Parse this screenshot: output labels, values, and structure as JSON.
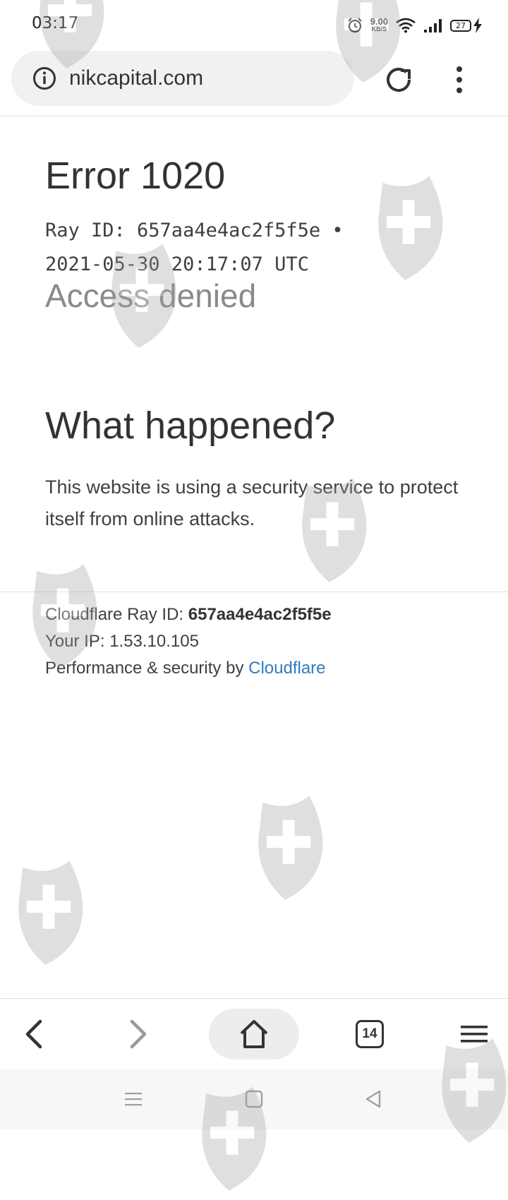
{
  "status_bar": {
    "time": "03:17",
    "net_speed_value": "9.00",
    "net_speed_unit": "KB/S",
    "battery": "27",
    "icons": [
      "alarm-icon",
      "wifi-icon",
      "signal-icon",
      "battery-icon",
      "charging-icon"
    ]
  },
  "browser": {
    "url": "nikcapital.com",
    "tab_count": "14",
    "icons": [
      "info-icon",
      "reload-icon",
      "more-vert-icon",
      "back-icon",
      "forward-icon",
      "home-icon",
      "tabs-icon",
      "menu-icon"
    ]
  },
  "page": {
    "error_title": "Error 1020",
    "ray_line1": "Ray ID: 657aa4e4ac2f5f5e •",
    "ray_line2": "2021-05-30 20:17:07 UTC",
    "access_denied": "Access denied",
    "what_happened": "What happened?",
    "explanation": "This website is using a security service to protect itself from online attacks.",
    "footer": {
      "ray_label": "Cloudflare Ray ID:",
      "ray_value": "657aa4e4ac2f5f5e",
      "ip_label": "Your IP:",
      "ip_value": "1.53.10.105",
      "perf_label": "Performance & security by",
      "perf_link": "Cloudflare"
    }
  },
  "colors": {
    "link": "#2f7bbf",
    "watermark": "#9e9e9e"
  }
}
